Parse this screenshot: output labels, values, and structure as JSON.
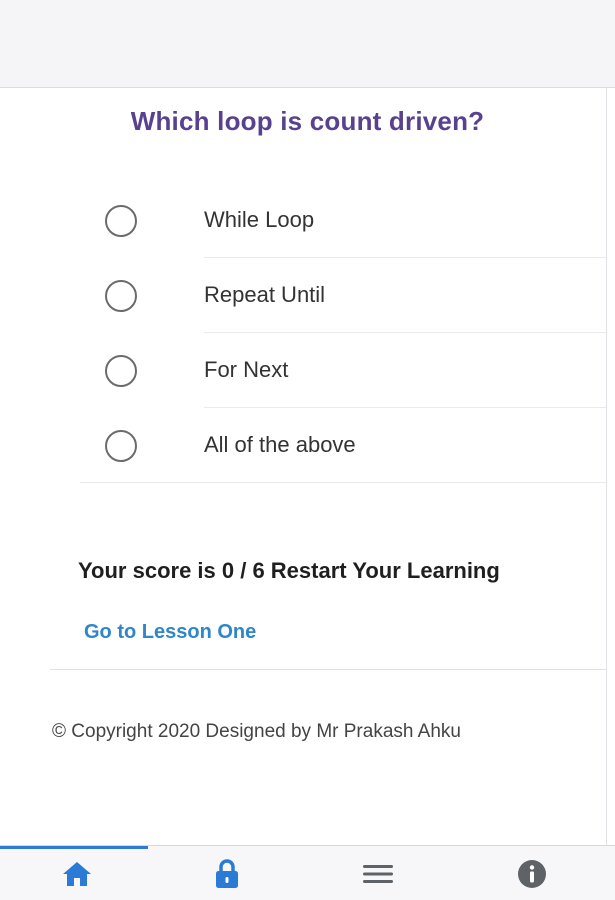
{
  "question": {
    "text": "Which loop is count driven?"
  },
  "options": [
    {
      "label": "While Loop"
    },
    {
      "label": "Repeat Until"
    },
    {
      "label": "For Next"
    },
    {
      "label": "All of the above"
    }
  ],
  "result": {
    "score_text": "Your score is 0 / 6 Restart Your Learning",
    "lesson_link": "Go to Lesson One"
  },
  "footer": {
    "copyright": "© Copyright 2020 Designed by Mr Prakash Ahku"
  },
  "tabbar": {
    "active_tab": "home",
    "tabs": [
      {
        "icon": "home-icon"
      },
      {
        "icon": "lock-icon"
      },
      {
        "icon": "menu-icon"
      },
      {
        "icon": "info-icon"
      }
    ],
    "colors": {
      "active": "#2b7bd6",
      "inactive": "#5f6368"
    }
  },
  "colors": {
    "question": "#58418f",
    "link": "#2f86c9"
  }
}
